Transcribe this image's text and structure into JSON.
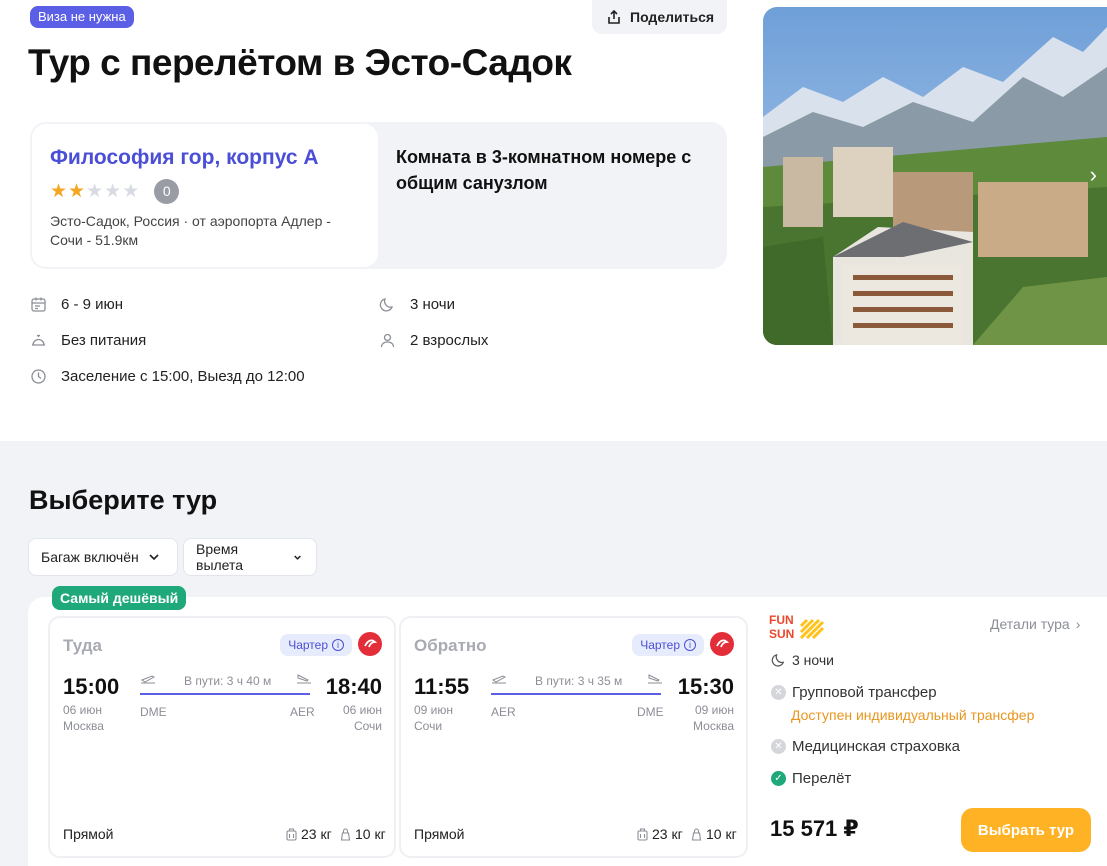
{
  "header": {
    "visa_badge": "Виза не нужна",
    "share_label": "Поделиться",
    "title": "Тур с перелётом в Эсто-Садок"
  },
  "hotel": {
    "name": "Философия гор, корпус А",
    "stars_total": 5,
    "stars_filled": 2,
    "rating": "0",
    "location": "Эсто-Садок, Россия",
    "distance": "от аэропорта Адлер - Сочи - 51.9км",
    "room": "Комната в 3-комнатном номере с общим санузлом"
  },
  "facts": {
    "dates": "6 - 9 июн",
    "nights": "3 ночи",
    "meals": "Без питания",
    "guests": "2 взрослых",
    "checkin": "Заселение с 15:00, Выезд до 12:00"
  },
  "tours": {
    "title": "Выберите тур",
    "filters": [
      "Багаж включён",
      "Время вылета"
    ],
    "cheapest_badge": "Самый дешёвый",
    "outbound": {
      "direction": "Туда",
      "charter": "Чартер",
      "dep_time": "15:00",
      "dep_date": "06 июн",
      "dep_city": "Москва",
      "dep_code": "DME",
      "duration": "В пути: 3 ч 40 м",
      "arr_time": "18:40",
      "arr_date": "06 июн",
      "arr_city": "Сочи",
      "arr_code": "AER",
      "type": "Прямой",
      "baggage": "23 кг",
      "hand": "10 кг"
    },
    "return": {
      "direction": "Обратно",
      "charter": "Чартер",
      "dep_time": "11:55",
      "dep_date": "09 июн",
      "dep_city": "Сочи",
      "dep_code": "AER",
      "duration": "В пути: 3 ч 35 м",
      "arr_time": "15:30",
      "arr_date": "09 июн",
      "arr_city": "Москва",
      "arr_code": "DME",
      "type": "Прямой",
      "baggage": "23 кг",
      "hand": "10 кг"
    },
    "operator_logo_text": "FUN & SUN",
    "details_label": "Детали тура",
    "nights": "3 ночи",
    "inclusions": [
      {
        "label": "Групповой трансфер",
        "included": false
      },
      {
        "label": "Медицинская страховка",
        "included": false
      },
      {
        "label": "Перелёт",
        "included": true
      }
    ],
    "transfer_note": "Доступен индивидуальный трансфер",
    "price": "15 571 ₽",
    "book_label": "Выбрать тур"
  },
  "colors": {
    "accent": "#4b4fd6",
    "green": "#1fa97b",
    "orange": "#ffb224",
    "airline_red": "#e32d38"
  }
}
